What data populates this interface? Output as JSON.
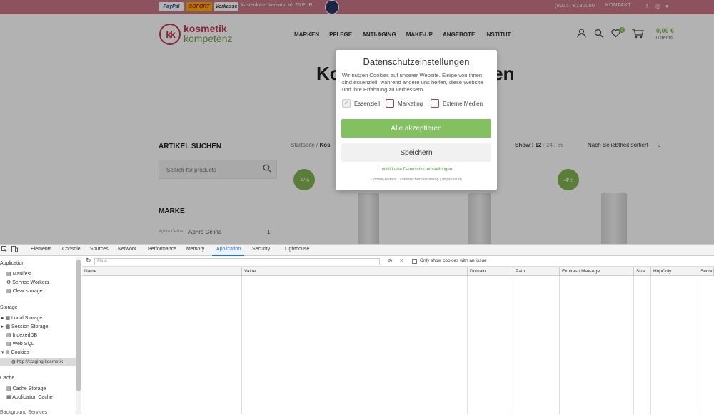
{
  "site": {
    "topbar": {
      "pay_logos": [
        "PayPal",
        "SOFORT",
        "Vorkasse"
      ],
      "shipping_text": "kostenloser Versand ab 25 EUR",
      "phone": "(0231) 8190000",
      "contact": "KONTAKT",
      "social": [
        "f",
        "◎",
        "●"
      ]
    },
    "logo": {
      "mark": "kk",
      "line1": "kosmetik",
      "line2": "kompetenz"
    },
    "nav": [
      "MARKEN",
      "PFLEGE",
      "ANTI-AGING",
      "MAKE-UP",
      "ANGEBOTE",
      "INSTITUT"
    ],
    "cart": {
      "badge": "0",
      "price": "0,00 €",
      "items": "0 Items"
    },
    "page_title_left": "Ko",
    "page_title_right": "en",
    "sidebar": {
      "search_title": "ARTIKEL SUCHEN",
      "search_placeholder": "Search for products",
      "marke_title": "MARKE",
      "brand_logo": "Aphro Celina",
      "brand_name": "Aphro Celina",
      "brand_count": "1"
    },
    "breadcrumb": {
      "home": "Startseite",
      "sep": "/",
      "current": "Kos"
    },
    "show": {
      "label": "Show :",
      "options": [
        "12",
        "24",
        "36"
      ],
      "sep": "/"
    },
    "sort": "Nach Beliebtheit sortiert",
    "sale_badges": [
      "-4%",
      "-4%"
    ],
    "modal": {
      "title": "Datenschutzeinstellungen",
      "text": "Wir nutzen Cookies auf unserer Website. Einige von ihnen sind essenziell, während andere uns helfen, diese Website und Ihre Erfahrung zu verbessern.",
      "checks": [
        "Essenziell",
        "Marketing",
        "Externe Medien"
      ],
      "accept_all": "Alle akzeptieren",
      "save": "Speichern",
      "individual": "Individuelle Datenschutzeinstellungen",
      "links": [
        "Cookie-Details",
        "Datenschutzerklärung",
        "Impressum"
      ],
      "link_sep": "|"
    }
  },
  "devtools": {
    "tabs": [
      "Elements",
      "Console",
      "Sources",
      "Network",
      "Performance",
      "Memory",
      "Application",
      "Security",
      "Lighthouse"
    ],
    "sidebar": {
      "app_header": "Application",
      "app_items": [
        "Manifest",
        "Service Workers",
        "Clear storage"
      ],
      "storage_header": "Storage",
      "storage_items": [
        "Local Storage",
        "Session Storage",
        "IndexedDB",
        "Web SQL",
        "Cookies"
      ],
      "cookie_origin": "http://staging.kosmetik-",
      "cache_header": "Cache",
      "cache_items": [
        "Cache Storage",
        "Application Cache"
      ],
      "bg_header": "Background Services"
    },
    "toolbar": {
      "filter_placeholder": "Filter",
      "only_issues_label": "Only show cookies with an issue"
    },
    "columns": [
      "Name",
      "Value",
      "Domain",
      "Path",
      "Expires / Max-Age",
      "Size",
      "HttpOnly",
      "Secure"
    ]
  }
}
